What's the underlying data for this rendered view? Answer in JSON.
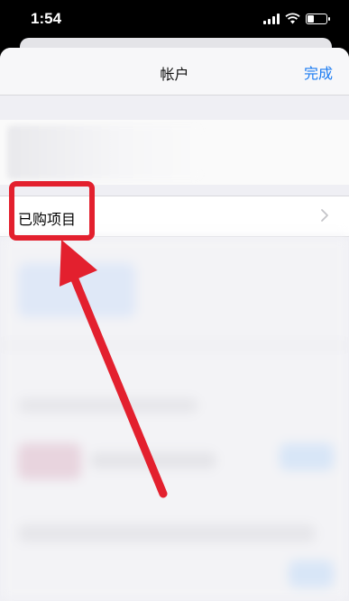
{
  "status_bar": {
    "time": "1:54"
  },
  "nav": {
    "title": "帐户",
    "done_label": "完成"
  },
  "list": {
    "purchased_label": "已购项目"
  },
  "colors": {
    "accent_blue": "#1a7bf2",
    "highlight_red": "#e3202e"
  }
}
